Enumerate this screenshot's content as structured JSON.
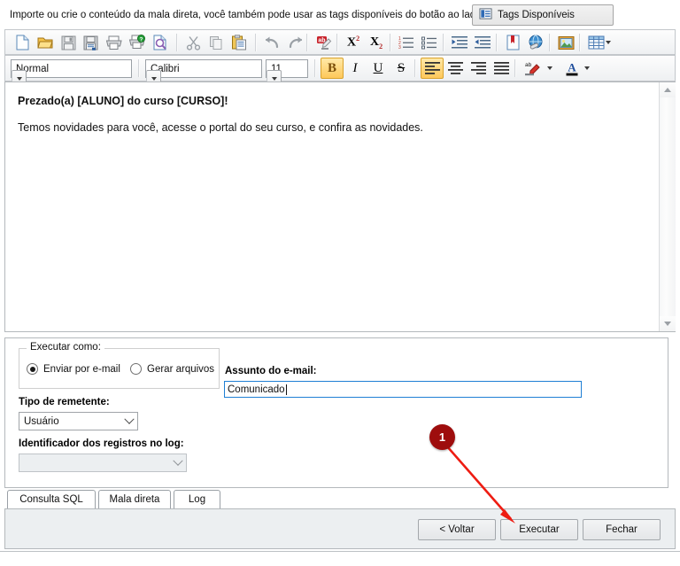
{
  "header": {
    "instruction": "Importe ou crie o conteúdo da mala direta, você também pode usar as tags disponíveis do botão ao lado:",
    "tags_button_label": "Tags Disponíveis",
    "tags_button_icon": "tags-list-icon"
  },
  "toolbar_file": {
    "items": [
      {
        "name": "new-document",
        "icon": "new-page-icon",
        "tooltip": "Novo"
      },
      {
        "name": "open-document",
        "icon": "open-folder-icon",
        "tooltip": "Abrir"
      },
      {
        "name": "save-document",
        "icon": "floppy-save-icon",
        "tooltip": "Salvar"
      },
      {
        "name": "save-as-document",
        "icon": "floppy-save-as-icon",
        "tooltip": "Salvar como"
      },
      {
        "name": "print-document",
        "icon": "printer-icon",
        "tooltip": "Imprimir"
      },
      {
        "name": "print-setup",
        "icon": "printer-help-icon",
        "tooltip": "Configurar impressão"
      },
      {
        "name": "print-preview",
        "icon": "page-magnifier-icon",
        "tooltip": "Visualizar impressão"
      },
      {
        "name": "cut",
        "icon": "scissors-icon",
        "tooltip": "Recortar"
      },
      {
        "name": "copy",
        "icon": "copy-pages-icon",
        "tooltip": "Copiar"
      },
      {
        "name": "paste",
        "icon": "clipboard-paste-icon",
        "tooltip": "Colar"
      },
      {
        "name": "undo",
        "icon": "undo-arrow-icon",
        "tooltip": "Desfazer"
      },
      {
        "name": "redo",
        "icon": "redo-arrow-icon",
        "tooltip": "Refazer"
      },
      {
        "name": "find-replace",
        "icon": "ab-replace-icon",
        "tooltip": "Localizar e substituir"
      },
      {
        "name": "superscript",
        "icon": "superscript-icon",
        "label": "X²"
      },
      {
        "name": "subscript",
        "icon": "subscript-icon",
        "label": "X₂"
      },
      {
        "name": "numbered-list",
        "icon": "numbered-list-icon",
        "tooltip": "Lista numerada"
      },
      {
        "name": "bulleted-list",
        "icon": "bulleted-list-icon",
        "tooltip": "Lista com marcadores"
      },
      {
        "name": "increase-indent",
        "icon": "increase-indent-icon",
        "tooltip": "Aumentar recuo"
      },
      {
        "name": "decrease-indent",
        "icon": "decrease-indent-icon",
        "tooltip": "Diminuir recuo"
      },
      {
        "name": "insert-bookmark",
        "icon": "bookmark-icon",
        "tooltip": "Marcador"
      },
      {
        "name": "insert-hyperlink",
        "icon": "globe-link-icon",
        "tooltip": "Hyperlink"
      },
      {
        "name": "insert-image",
        "icon": "picture-icon",
        "tooltip": "Imagem"
      },
      {
        "name": "insert-table",
        "icon": "table-grid-icon",
        "tooltip": "Tabela"
      }
    ]
  },
  "toolbar_format": {
    "style_combo": {
      "value": "Normal"
    },
    "font_combo": {
      "value": "Calibri"
    },
    "size_combo": {
      "value": "11"
    },
    "bold": {
      "label": "B",
      "active": true
    },
    "italic": {
      "label": "I",
      "active": false
    },
    "underline": {
      "label": "U",
      "active": false
    },
    "strikethrough": {
      "label": "S",
      "active": false
    },
    "align_left": {
      "icon": "align-left-icon",
      "active": true
    },
    "align_center": {
      "icon": "align-center-icon",
      "active": false
    },
    "align_right": {
      "icon": "align-right-icon",
      "active": false
    },
    "align_justify": {
      "icon": "align-justify-icon",
      "active": false
    },
    "highlight_color": {
      "icon": "highlighter-icon"
    },
    "font_color": {
      "icon": "font-color-a-icon"
    }
  },
  "editor": {
    "line1": "Prezado(a) [ALUNO] do curso [CURSO]!",
    "line2": "Temos novidades para você, acesse o portal do seu curso, e confira as novidades."
  },
  "options": {
    "group_title": "Executar como:",
    "radio_email_label": "Enviar por e-mail",
    "radio_email_selected": true,
    "radio_files_label": "Gerar arquivos",
    "radio_files_selected": false,
    "sender_type_label": "Tipo de remetente:",
    "sender_type_value": "Usuário",
    "log_identifier_label": "Identificador dos registros no log:",
    "log_identifier_value": "",
    "subject_label": "Assunto do e-mail:",
    "subject_value": "Comunicado"
  },
  "tabs": [
    {
      "label": "Consulta SQL",
      "active": false
    },
    {
      "label": "Mala direta",
      "active": true
    },
    {
      "label": "Log",
      "active": false
    }
  ],
  "footer": {
    "back_label": "< Voltar",
    "execute_label": "Executar",
    "close_label": "Fechar"
  },
  "annotation": {
    "step_number": "1",
    "color": "#9e0d0d",
    "arrow_color": "#ee1c12"
  }
}
